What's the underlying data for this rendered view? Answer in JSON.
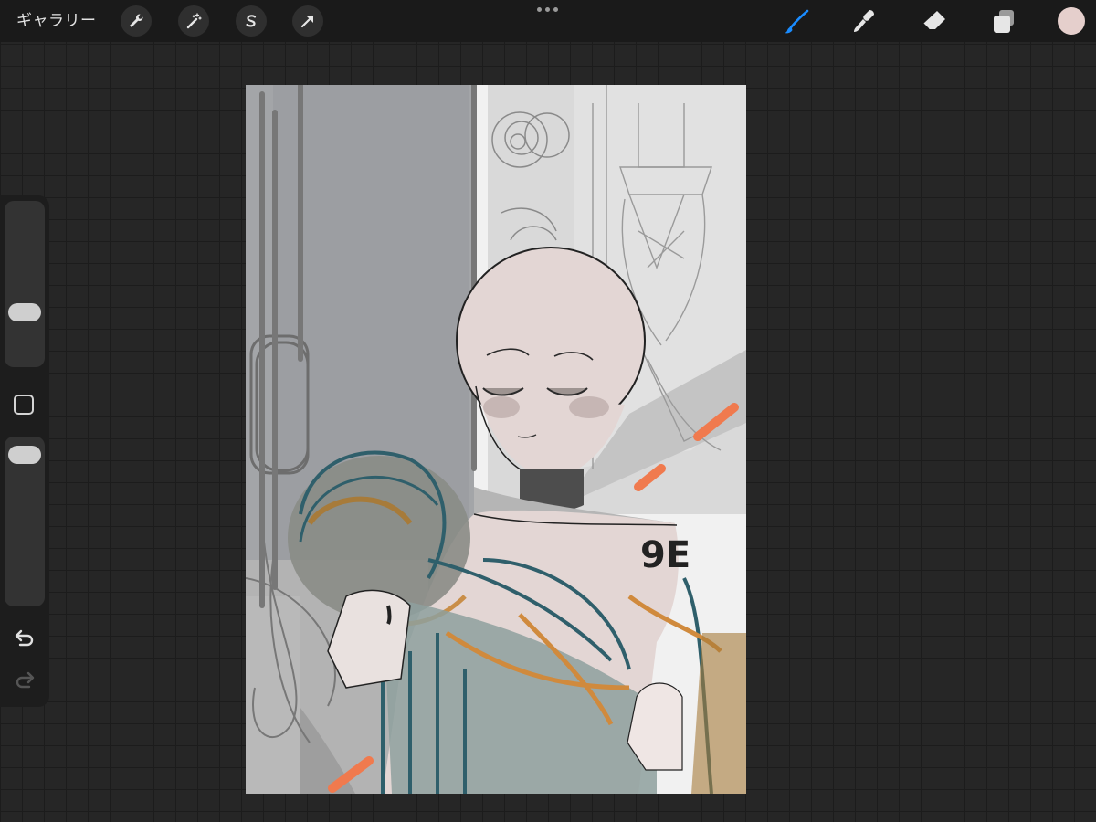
{
  "app": {
    "gallery_label": "ギャラリー",
    "current_color": "#e5cfcc",
    "accent_color": "#1a8cff"
  },
  "toolbar": {
    "left_tools": [
      "actions-wrench-icon",
      "adjustments-wand-icon",
      "selection-s-icon",
      "transform-arrow-icon"
    ],
    "right_tools": [
      "brush-icon",
      "smudge-icon",
      "eraser-icon",
      "layers-icon"
    ],
    "active_tool": "brush"
  },
  "sidebar": {
    "brush_size": 0.4,
    "opacity": 0.95
  }
}
